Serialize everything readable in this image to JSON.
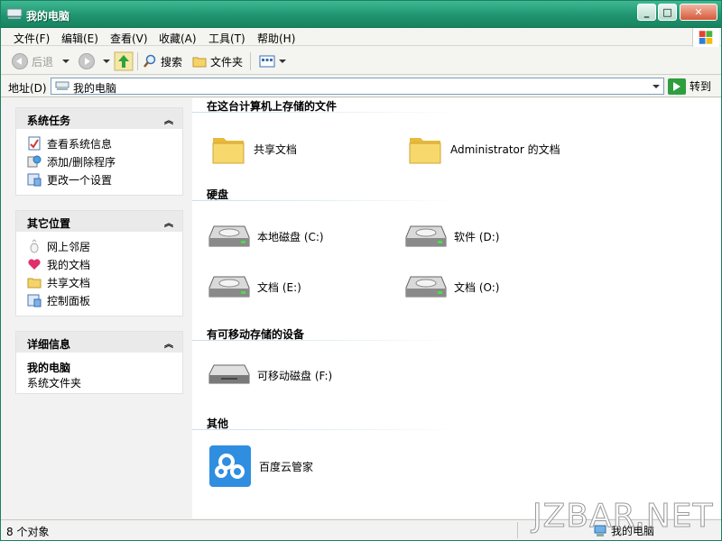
{
  "window": {
    "title": "我的电脑"
  },
  "menu": [
    {
      "label": "文件(F)"
    },
    {
      "label": "编辑(E)"
    },
    {
      "label": "查看(V)"
    },
    {
      "label": "收藏(A)"
    },
    {
      "label": "工具(T)"
    },
    {
      "label": "帮助(H)"
    }
  ],
  "toolbar": {
    "back": "后退",
    "search": "搜索",
    "folders": "文件夹"
  },
  "address": {
    "label": "地址(D)",
    "value": "我的电脑",
    "go": "转到"
  },
  "tasks": {
    "title": "系统任务",
    "items": [
      {
        "label": "查看系统信息"
      },
      {
        "label": "添加/删除程序"
      },
      {
        "label": "更改一个设置"
      }
    ]
  },
  "places": {
    "title": "其它位置",
    "items": [
      {
        "label": "网上邻居"
      },
      {
        "label": "我的文档"
      },
      {
        "label": "共享文档"
      },
      {
        "label": "控制面板"
      }
    ]
  },
  "details": {
    "title": "详细信息",
    "name": "我的电脑",
    "desc": "系统文件夹"
  },
  "groups": {
    "stored": {
      "title": "在这台计算机上存储的文件",
      "items": [
        {
          "label": "共享文档"
        },
        {
          "label": "Administrator 的文档"
        }
      ]
    },
    "harddisk": {
      "title": "硬盘",
      "items": [
        {
          "label": "本地磁盘 (C:)"
        },
        {
          "label": "软件 (D:)"
        },
        {
          "label": "文档 (E:)"
        },
        {
          "label": "文档 (O:)"
        }
      ]
    },
    "removable": {
      "title": "有可移动存储的设备",
      "items": [
        {
          "label": "可移动磁盘 (F:)"
        }
      ]
    },
    "other": {
      "title": "其他",
      "items": [
        {
          "label": "百度云管家"
        }
      ]
    }
  },
  "status": {
    "count": "8 个对象",
    "location": "我的电脑"
  },
  "watermark": "JZBAR.NET"
}
